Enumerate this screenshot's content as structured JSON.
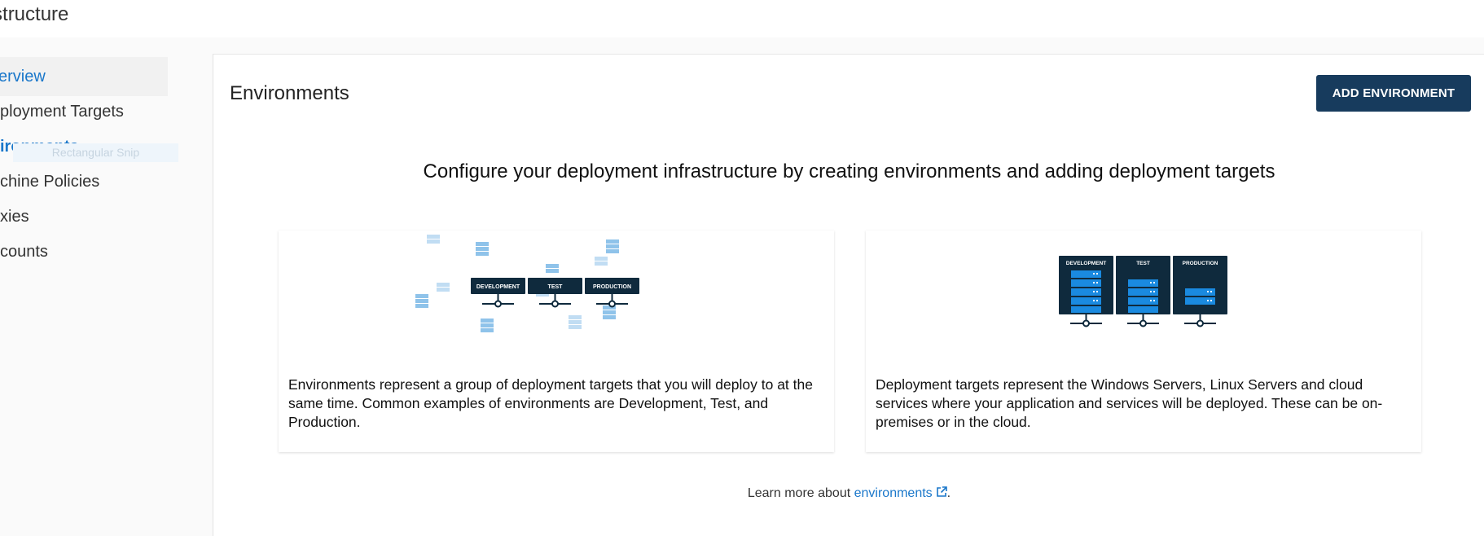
{
  "header": {
    "title": "Infrastructure"
  },
  "sidebar": {
    "items": [
      {
        "label": "Overview",
        "visible": "erview"
      },
      {
        "label": "Deployment Targets",
        "visible": "ployment Targets"
      },
      {
        "label": "Environments",
        "visible": "ironments"
      },
      {
        "label": "Machine Policies",
        "visible": "chine Policies"
      },
      {
        "label": "Proxies",
        "visible": "xies"
      },
      {
        "label": "Accounts",
        "visible": "counts"
      }
    ]
  },
  "overlay": {
    "snip_label": "Rectangular Snip"
  },
  "main": {
    "title": "Environments",
    "add_button": "ADD ENVIRONMENT",
    "headline": "Configure your deployment infrastructure by creating environments and adding deployment targets",
    "cards": [
      {
        "text": "Environments represent a group of deployment targets that you will deploy to at the same time. Common examples of environments are Development, Test, and Production.",
        "labels": [
          "DEVELOPMENT",
          "TEST",
          "PRODUCTION"
        ]
      },
      {
        "text": "Deployment targets represent the Windows Servers, Linux Servers and cloud services where your application and services will be deployed. These can be on-premises or in the cloud.",
        "labels": [
          "DEVELOPMENT",
          "TEST",
          "PRODUCTION"
        ]
      }
    ],
    "learn_more_prefix": "Learn more about",
    "learn_more_link": "environments",
    "learn_more_suffix": "."
  },
  "colors": {
    "brand_dark": "#173b5d",
    "link_blue": "#1a77ca",
    "server_blue": "#1a8ae0",
    "server_light": "#a7d0ee"
  },
  "icons": {
    "external_link": "external-link-icon"
  }
}
